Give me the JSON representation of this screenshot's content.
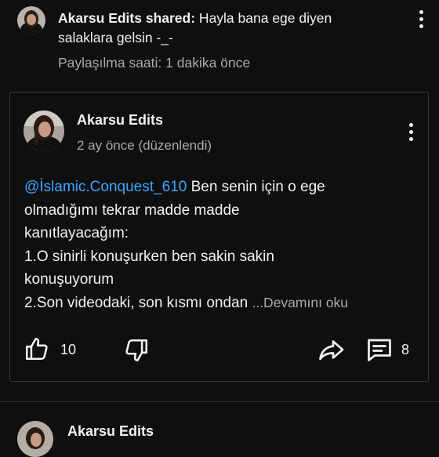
{
  "share": {
    "author": "Akarsu Edits",
    "shared_word": " shared:",
    "message_line1": " Hayla bana ege diyen",
    "message_line2": "salaklara gelsin -_-",
    "time_label": "Paylaşılma saati: 1 dakika önce"
  },
  "post": {
    "author": "Akarsu Edits",
    "time": "2 ay önce (düzenlendi)",
    "mention": "@İslamic.Conquest_610",
    "line1_rest": " Ben senin için o ege",
    "line2": "olmadığımı tekrar madde madde",
    "line3": "kanıtlayacağım:",
    "line4": "1.O sinirli konuşurken ben sakin sakin",
    "line5": "konuşuyorum",
    "line6": "2.Son videodaki, son kısmı ondan ",
    "read_more": "...Devamını oku",
    "like_count": "10",
    "comment_count": "8"
  },
  "next_post": {
    "author": "Akarsu Edits"
  },
  "icons": {
    "more": "more-vert-icon",
    "like": "thumb-up-icon",
    "dislike": "thumb-down-icon",
    "share": "share-icon",
    "comment": "comment-icon"
  },
  "colors": {
    "background": "#0f0f0f",
    "mention": "#3ea6ff",
    "secondary_text": "#aaaaaa"
  }
}
